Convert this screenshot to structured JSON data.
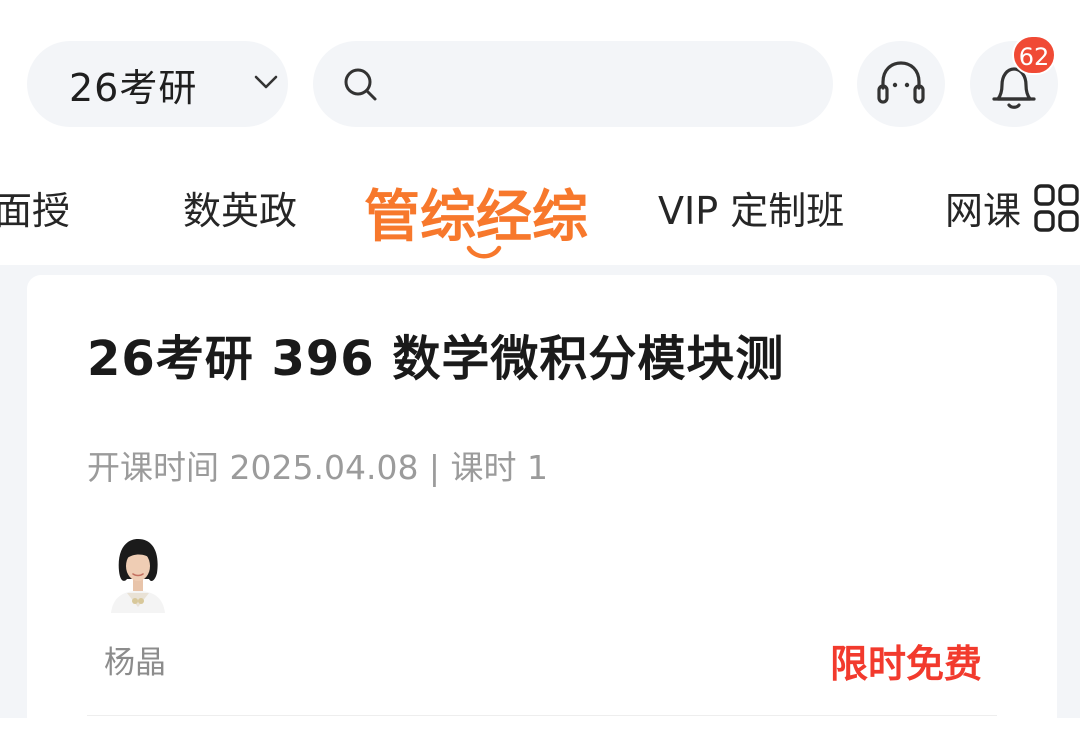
{
  "header": {
    "exam_selector_label": "26考研",
    "search_placeholder": "",
    "notification_count": "62"
  },
  "tabs": [
    {
      "label": "面授",
      "active": false
    },
    {
      "label": "数英政",
      "active": false
    },
    {
      "label": "管综经综",
      "active": true
    },
    {
      "label": "VIP 定制班",
      "active": false
    },
    {
      "label": "网课",
      "active": false
    }
  ],
  "course": {
    "title": "26考研 396 数学微积分模块测",
    "meta": "开课时间 2025.04.08 | 课时 1",
    "teacher_name": "杨晶",
    "price_label": "限时免费"
  },
  "colors": {
    "accent": "#f7782c",
    "price": "#f23a2d",
    "badge": "#f04a35",
    "pill_bg": "#f3f5f8"
  },
  "icons": [
    "chevron-down-icon",
    "search-icon",
    "customer-service-icon",
    "bell-icon",
    "grid-menu-icon",
    "tab-smile-indicator-icon"
  ]
}
